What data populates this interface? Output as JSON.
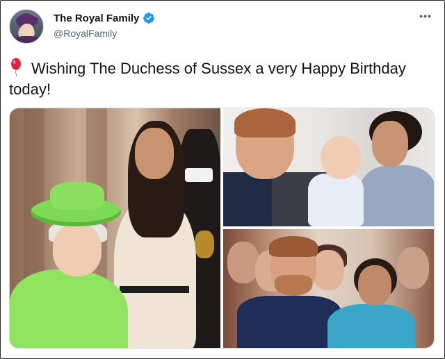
{
  "tweet": {
    "author": {
      "display_name": "The Royal Family",
      "handle": "@RoyalFamily",
      "verified": true,
      "avatar_icon": "queen-portrait-avatar"
    },
    "more_label": "•••",
    "text": "Wishing The Duchess of Sussex a very Happy Birthday today!",
    "emoji_icon": "balloon-icon",
    "media": [
      {
        "position": "left",
        "subject": "Queen in green hat and Duchess in cream dress"
      },
      {
        "position": "top-right",
        "subject": "Prince Harry with baby and Duchess"
      },
      {
        "position": "bottom-right",
        "subject": "Prince Harry and Duchess smiling in crowd"
      }
    ]
  },
  "colors": {
    "verified_blue": "#1d9bf0",
    "balloon_red": "#e0253a",
    "handle_gray": "#536471",
    "text_dark": "#0f1419"
  }
}
